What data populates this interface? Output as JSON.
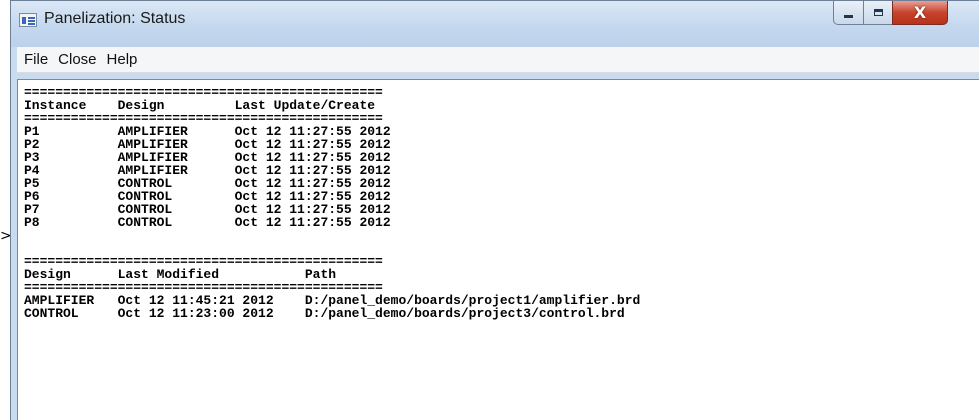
{
  "window": {
    "title": "Panelization: Status",
    "controls": {
      "minimize": "minimize",
      "maximize": "maximize",
      "close": "X"
    }
  },
  "menu": [
    "File",
    "Close",
    "Help"
  ],
  "status_text": "==============================================\nInstance    Design         Last Update/Create\n==============================================\nP1          AMPLIFIER      Oct 12 11:27:55 2012\nP2          AMPLIFIER      Oct 12 11:27:55 2012\nP3          AMPLIFIER      Oct 12 11:27:55 2012\nP4          AMPLIFIER      Oct 12 11:27:55 2012\nP5          CONTROL        Oct 12 11:27:55 2012\nP6          CONTROL        Oct 12 11:27:55 2012\nP7          CONTROL        Oct 12 11:27:55 2012\nP8          CONTROL        Oct 12 11:27:55 2012\n\n\n==============================================\nDesign      Last Modified           Path\n==============================================\nAMPLIFIER   Oct 12 11:45:21 2012    D:/panel_demo/boards/project1/amplifier.brd\nCONTROL     Oct 12 11:23:00 2012    D:/panel_demo/boards/project3/control.brd",
  "pointer": ">"
}
